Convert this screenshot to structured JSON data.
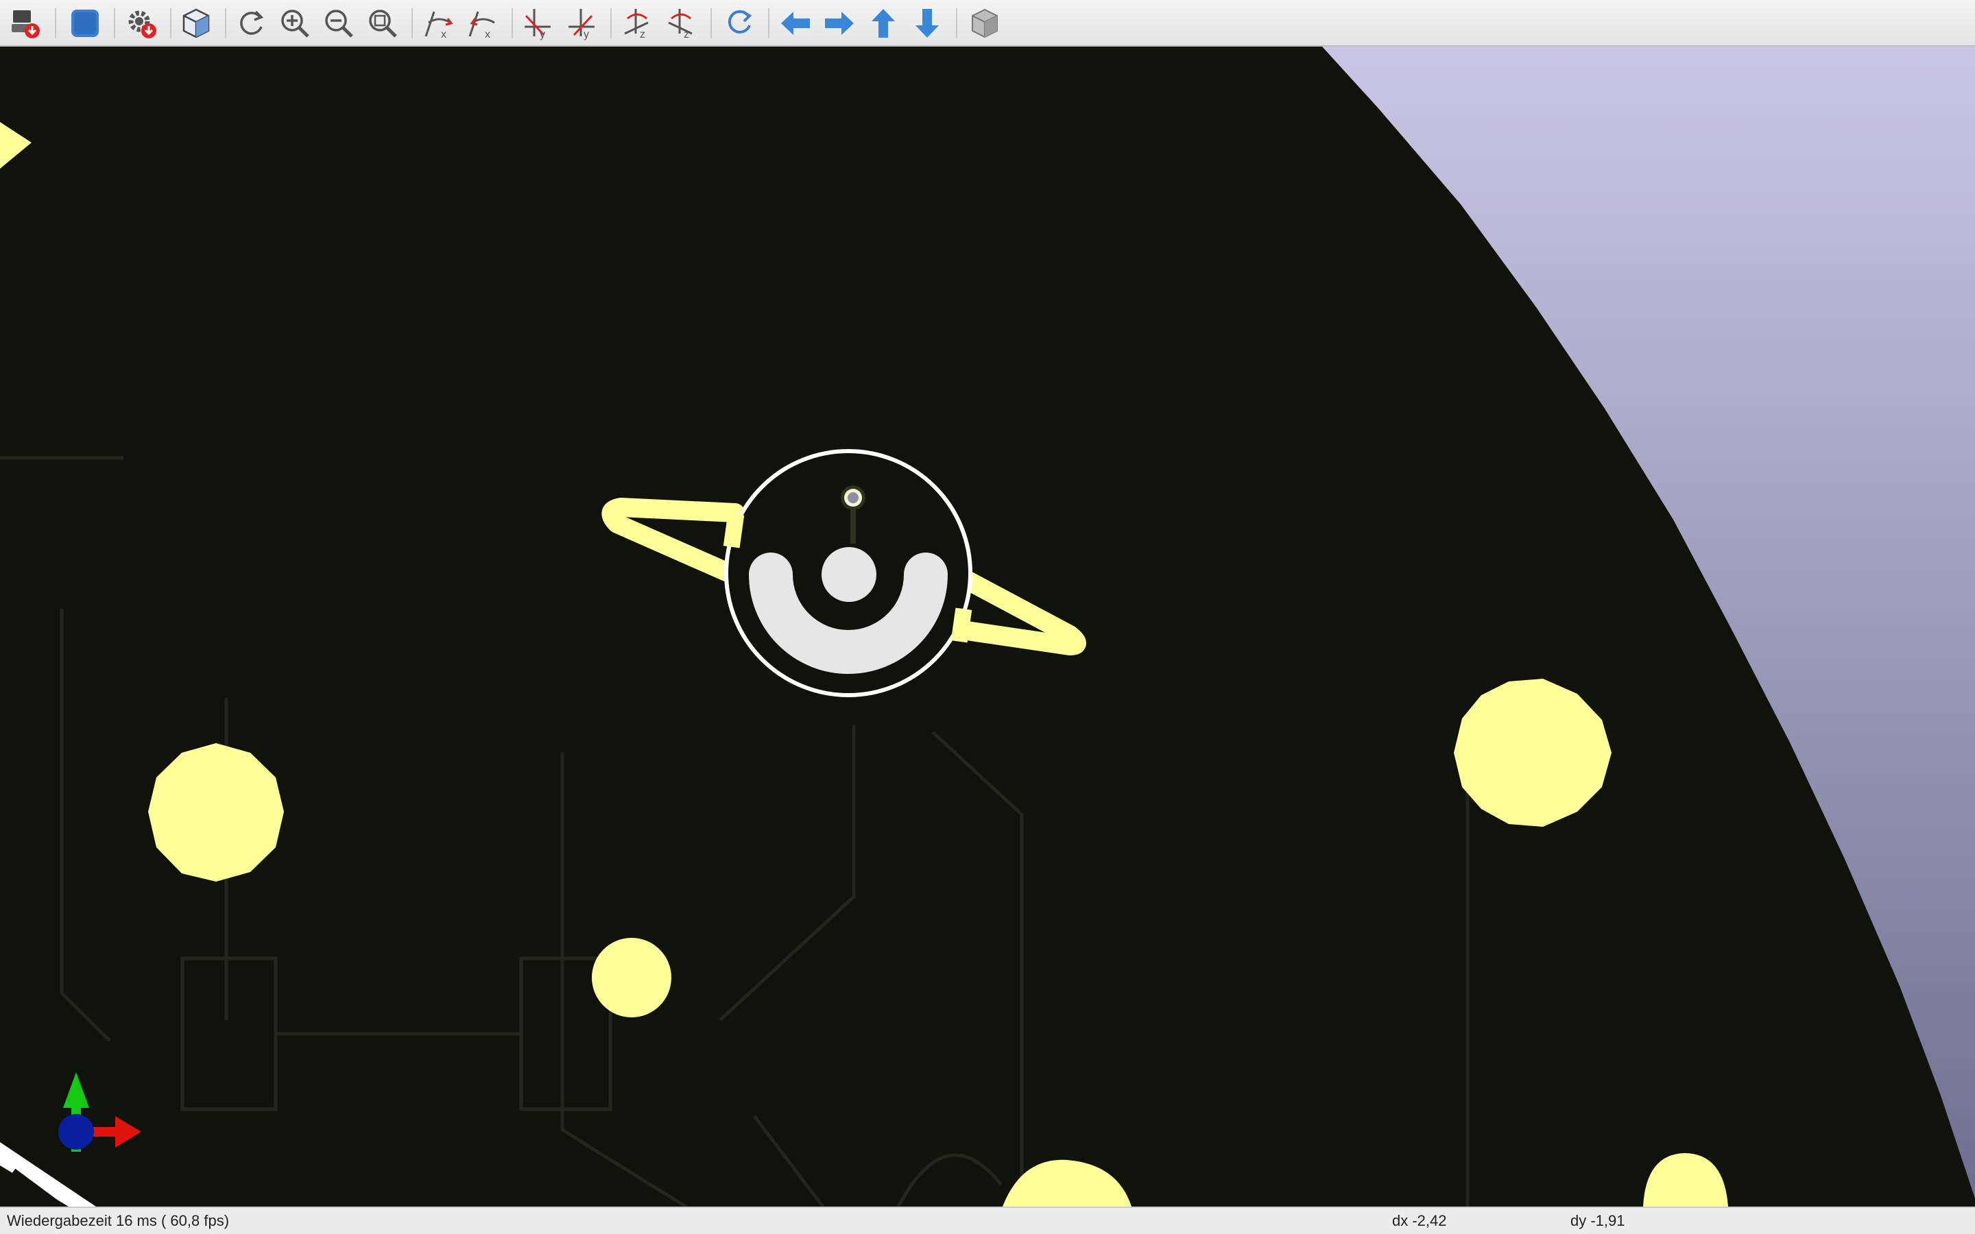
{
  "toolbar": {
    "buttons": [
      {
        "name": "export-step-button",
        "icon": "export-icon"
      },
      {
        "name": "board-color-button",
        "icon": "board-color-icon"
      },
      {
        "name": "settings-button",
        "icon": "gear-icon"
      },
      {
        "name": "view-orthographic-button",
        "icon": "cube-wireframe-icon"
      },
      {
        "name": "reload-button",
        "icon": "refresh-icon"
      },
      {
        "name": "zoom-in-button",
        "icon": "zoom-in-icon"
      },
      {
        "name": "zoom-out-button",
        "icon": "zoom-out-icon"
      },
      {
        "name": "zoom-fit-button",
        "icon": "zoom-fit-icon"
      },
      {
        "name": "rotate-x-cw-button",
        "icon": "rotate-x-cw-icon",
        "label": "x"
      },
      {
        "name": "rotate-x-ccw-button",
        "icon": "rotate-x-ccw-icon",
        "label": "x"
      },
      {
        "name": "rotate-y-cw-button",
        "icon": "rotate-y-cw-icon",
        "label": "y"
      },
      {
        "name": "rotate-y-ccw-button",
        "icon": "rotate-y-ccw-icon",
        "label": "y"
      },
      {
        "name": "rotate-z-cw-button",
        "icon": "rotate-z-cw-icon",
        "label": "z"
      },
      {
        "name": "rotate-z-ccw-button",
        "icon": "rotate-z-ccw-icon",
        "label": "z"
      },
      {
        "name": "flip-board-button",
        "icon": "flip-icon"
      },
      {
        "name": "move-left-button",
        "icon": "arrow-left-icon"
      },
      {
        "name": "move-right-button",
        "icon": "arrow-right-icon"
      },
      {
        "name": "move-up-button",
        "icon": "arrow-up-icon"
      },
      {
        "name": "move-down-button",
        "icon": "arrow-down-icon"
      },
      {
        "name": "view-3d-button",
        "icon": "cube-solid-icon"
      }
    ]
  },
  "viewport": {
    "board_color": "#10120c",
    "copper_color": "#ffff99",
    "silkscreen_color": "#e6e6e6",
    "background_gradient": [
      "#c8c8e6",
      "#6e6e8e"
    ],
    "axes": {
      "x_color": "#e0140a",
      "y_color": "#14c814",
      "z_color": "#0a1ea0"
    }
  },
  "status": {
    "render_time": "Wiedergabezeit 16 ms ( 60,8 fps)",
    "dx": "dx -2,42",
    "dy": "dy -1,91"
  }
}
